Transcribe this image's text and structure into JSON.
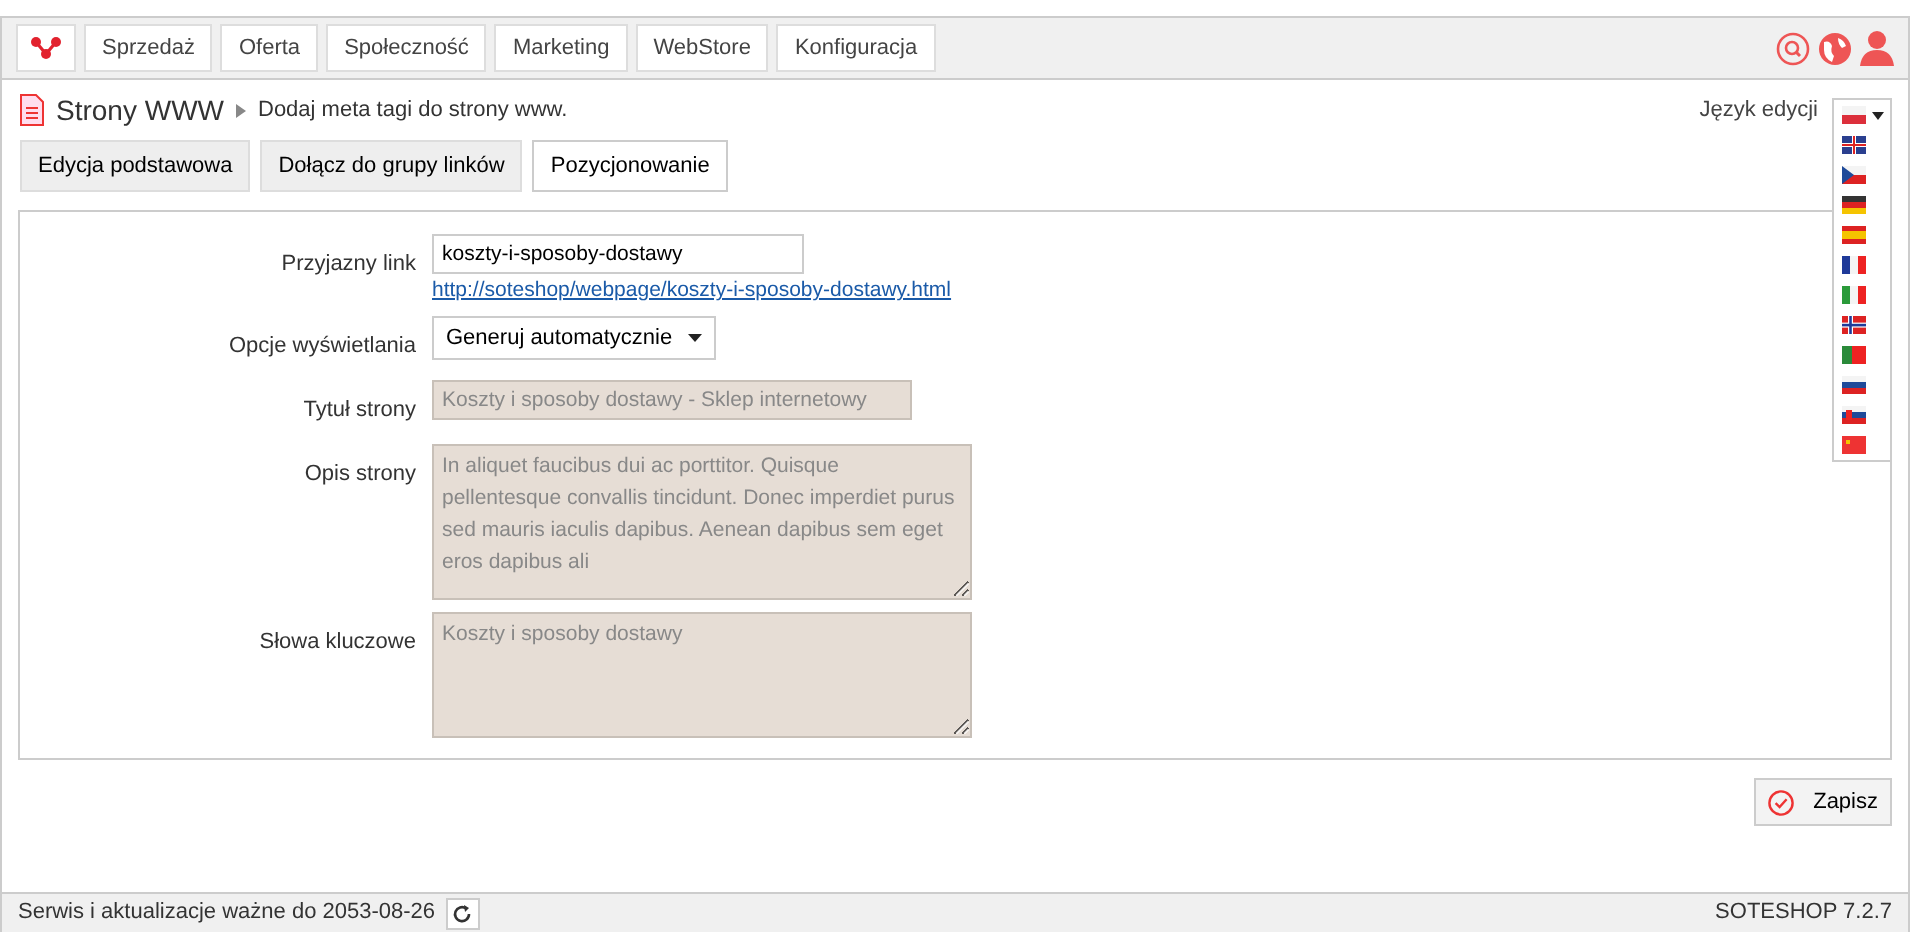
{
  "nav": {
    "items": [
      {
        "label": "Sprzedaż"
      },
      {
        "label": "Oferta"
      },
      {
        "label": "Społeczność"
      },
      {
        "label": "Marketing"
      },
      {
        "label": "WebStore"
      },
      {
        "label": "Konfiguracja"
      }
    ]
  },
  "header": {
    "title": "Strony WWW",
    "breadcrumb": "Dodaj meta tagi do strony www.",
    "language_label": "Język edycji",
    "language_menu_expanded": true
  },
  "tabs": [
    {
      "label": "Edycja podstawowa",
      "selected": false
    },
    {
      "label": "Dołącz do grupy linków",
      "selected": false
    },
    {
      "label": "Pozycjonowanie",
      "selected": true
    }
  ],
  "form": [
    {
      "kind": "input",
      "label": "Przyjazny link",
      "value": "koszty-i-sposoby-dostawy",
      "link": "http://soteshop/webpage/koszty-i-sposoby-dostawy.html"
    },
    {
      "kind": "select",
      "label": "Opcje wyświetlania",
      "value": "Generuj automatycznie"
    },
    {
      "kind": "input",
      "label": "Tytuł strony",
      "value": "Koszty i sposoby dostawy - Sklep internetowy",
      "disabled": true
    },
    {
      "kind": "textarea",
      "label": "Opis strony",
      "value": "In aliquet faucibus dui ac porttitor. Quisque pellentesque convallis tincidunt. Donec imperdiet purus sed mauris iaculis dapibus. Aenean dapibus sem eget eros dapibus ali",
      "disabled": true
    },
    {
      "kind": "textarea",
      "label": "Słowa kluczowe",
      "value": "Koszty i sposoby dostawy",
      "disabled": true
    }
  ],
  "save_button": "Zapisz",
  "status_bar": {
    "left": "Serwis i aktualizacje ważne do 2053-08-26",
    "right": "SOTESHOP 7.2.7"
  }
}
